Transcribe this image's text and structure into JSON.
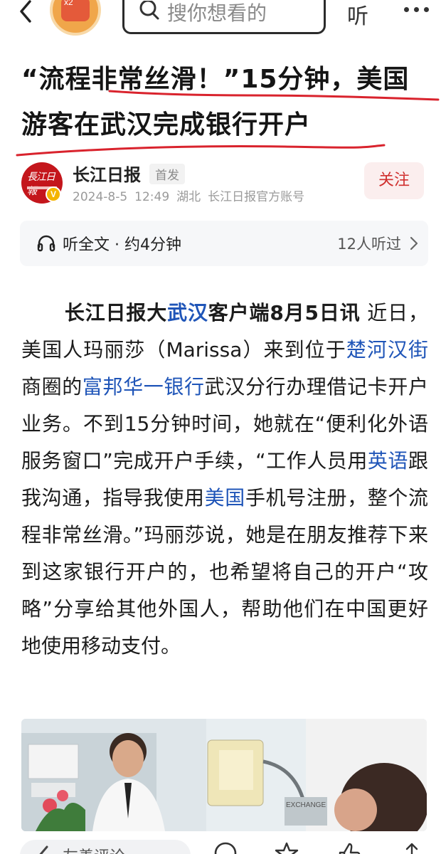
{
  "header": {
    "back_icon": "chevron-left-icon",
    "badge_text": "x2",
    "search_placeholder": "搜你想看的",
    "listen_label": "听",
    "more_icon": "more-dots-icon"
  },
  "article": {
    "headline_line1": "“流程非常丝滑！”15分钟，美国",
    "headline_line2": "游客在武汉完成银行开户",
    "author": {
      "name": "长江日报",
      "logo_text": "長江日報",
      "tag": "首发",
      "date": "2024-8-5",
      "time": "12:49",
      "region": "湖北",
      "account": "长江日报官方账号",
      "follow_label": "关注"
    },
    "listen": {
      "label": "听全文 · 约4分钟",
      "count": "12人听过"
    },
    "body": {
      "lead_1": "长江日报大",
      "lead_link": "武汉",
      "lead_2": "客户端8月5日讯",
      "p1": " 近日，美国人玛丽莎（Marissa）来到位于",
      "link_chuhe": "楚河汉街",
      "p2": "商圈的",
      "link_bank": "富邦华一银行",
      "p3": "武汉分行办理借记卡开户业务。不到15分钟时间，她就在“便利化外语服务窗口”完成开户手续，“工作人员用",
      "link_english": "英语",
      "p4": "跟我沟通，指导我使用",
      "link_us": "美国",
      "p5": "手机号注册，整个流程非常丝滑。”玛丽莎说，她是在朋友推荐下来到这家银行开户的，也希望将自己的开户“攻略”分享给其他外国人，帮助他们在中国更好地使用移动支付。"
    },
    "photo_sign": "EXCHANGE"
  },
  "bottombar": {
    "comment_placeholder": "友善评论"
  },
  "colors": {
    "link": "#1f55b8",
    "follow": "#d0302f",
    "annotation_red": "#d9232d"
  }
}
